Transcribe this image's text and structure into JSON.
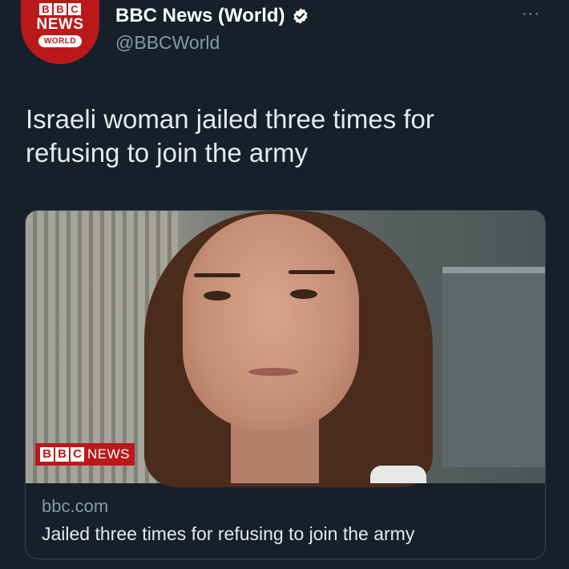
{
  "account": {
    "avatar": {
      "letters": [
        "B",
        "B",
        "C"
      ],
      "news_word": "NEWS",
      "world_word": "WORLD"
    },
    "display_name": "BBC News (World)",
    "handle": "@BBCWorld",
    "more_label": "···"
  },
  "tweet": {
    "text_line1": "Israeli woman jailed three times for",
    "text_line2": "refusing to join the army"
  },
  "card": {
    "badge": {
      "letters": [
        "B",
        "B",
        "C"
      ],
      "news_word": "NEWS"
    },
    "domain": "bbc.com",
    "title": "Jailed three times for refusing to join the army"
  },
  "colors": {
    "background": "#15202b",
    "bbc_red": "#bb1919",
    "verified_badge": "#ffffff",
    "secondary_text": "#8b98a5"
  },
  "icons": {
    "verified": "verified-badge-icon",
    "more": "more-options-icon"
  }
}
